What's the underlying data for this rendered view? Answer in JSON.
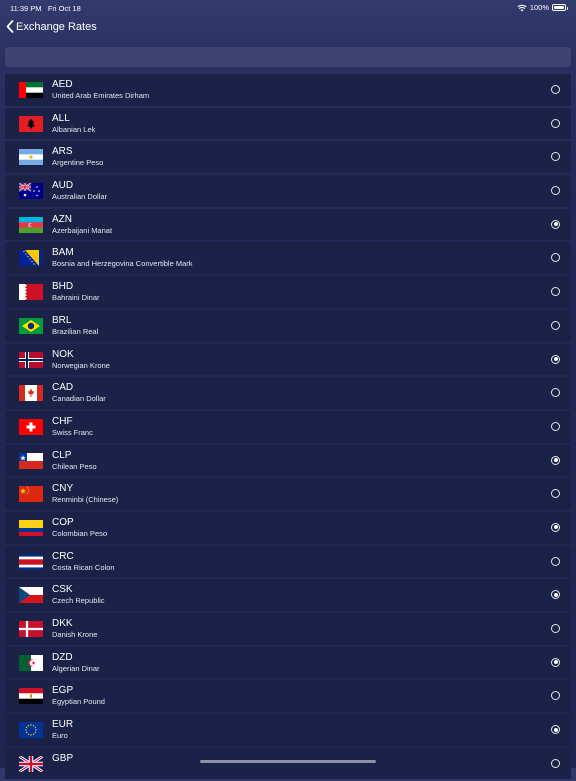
{
  "status": {
    "time": "11:39 PM",
    "date": "Fri Oct 18",
    "battery": "100%"
  },
  "nav": {
    "title": "Exchange Rates"
  },
  "currencies": [
    {
      "code": "AED",
      "name": "United Arab Emirates Dirham",
      "selected": false
    },
    {
      "code": "ALL",
      "name": "Albanian Lek",
      "selected": false
    },
    {
      "code": "ARS",
      "name": "Argentine Peso",
      "selected": false
    },
    {
      "code": "AUD",
      "name": "Australian Dollar",
      "selected": false
    },
    {
      "code": "AZN",
      "name": "Azerbaijani Manat",
      "selected": true
    },
    {
      "code": "BAM",
      "name": "Bosnia and Herzegovina Convertible Mark",
      "selected": false
    },
    {
      "code": "BHD",
      "name": "Bahraini Dinar",
      "selected": false
    },
    {
      "code": "BRL",
      "name": "Brazilian Real",
      "selected": false
    },
    {
      "code": "NOK",
      "name": "Norwegian Krone",
      "selected": true
    },
    {
      "code": "CAD",
      "name": "Canadian Dollar",
      "selected": false
    },
    {
      "code": "CHF",
      "name": "Swiss Franc",
      "selected": false
    },
    {
      "code": "CLP",
      "name": "Chilean Peso",
      "selected": true
    },
    {
      "code": "CNY",
      "name": "Renminbi (Chinese)",
      "selected": false
    },
    {
      "code": "COP",
      "name": "Colombian Peso",
      "selected": true
    },
    {
      "code": "CRC",
      "name": "Costa Rican Colon",
      "selected": false
    },
    {
      "code": "CSK",
      "name": "Czech Republic",
      "selected": true
    },
    {
      "code": "DKK",
      "name": "Danish Krone",
      "selected": false
    },
    {
      "code": "DZD",
      "name": "Algerian Dinar",
      "selected": true
    },
    {
      "code": "EGP",
      "name": "Egyptian Pound",
      "selected": false
    },
    {
      "code": "EUR",
      "name": "Euro",
      "selected": true
    },
    {
      "code": "GBP",
      "name": "",
      "selected": false
    }
  ]
}
